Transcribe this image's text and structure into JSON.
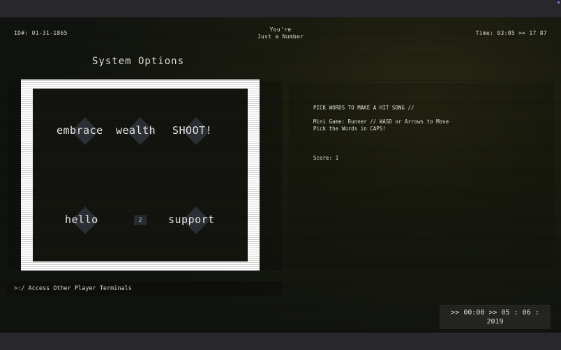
{
  "header": {
    "id_label": "ID#: 01-31-1865",
    "title_line1": "You're",
    "title_line2": "Just a Number",
    "time_label": "Time: 03:05 >> 17 87"
  },
  "system_title": "System Options",
  "game": {
    "words_top": [
      "embrace",
      "wealth",
      "SHOOT!"
    ],
    "words_bottom": [
      "hello",
      "support"
    ],
    "player_label": "2"
  },
  "info": {
    "heading": "PICK WORDS TO MAKE A HIT SONG //",
    "mode_line": "Mini Game: Runner // WASD or Arrows to Move",
    "hint_line": "Pick the Words in CAPS!",
    "score": "Score: 1"
  },
  "access_label": ">:/ Access Other Player Terminals",
  "clock": {
    "line1": ">> 00:00 >> 05 : 06 :",
    "line2": "2019"
  },
  "colors": {
    "frame": "#ffffff",
    "arena": "#14150f",
    "tile": "#2e3238"
  }
}
